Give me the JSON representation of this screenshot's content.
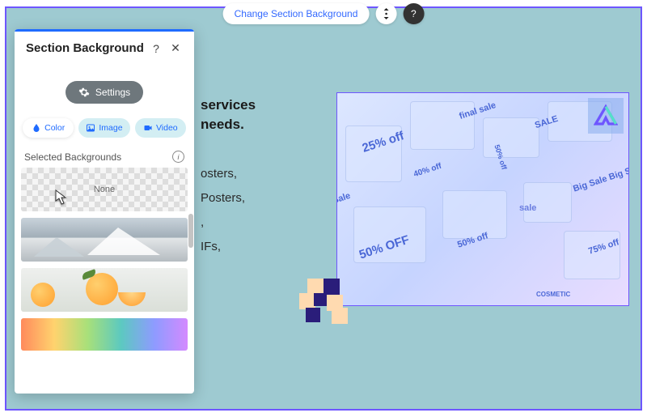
{
  "toolbar": {
    "change_bg": "Change Section Background"
  },
  "panel": {
    "title": "Section Background",
    "settings_label": "Settings",
    "tabs": {
      "color": "Color",
      "image": "Image",
      "video": "Video"
    },
    "selected_label": "Selected Backgrounds",
    "none_label": "None"
  },
  "content": {
    "heading_l1": "services",
    "heading_l2": "needs.",
    "line1": "osters,",
    "line2": "Posters,",
    "line3": ",",
    "line4": "IFs,"
  },
  "image_tags": [
    "final sale",
    "25% off",
    "SALE",
    "Sale",
    "50% OFF",
    "40% off",
    "sale",
    "50% off",
    "Big Sale Big Sal",
    "75% off",
    "50% off",
    "COSMETIC"
  ],
  "colors": {
    "accent": "#1f6bff",
    "frame": "#6e56ff",
    "canvas": "#9ecad1"
  }
}
